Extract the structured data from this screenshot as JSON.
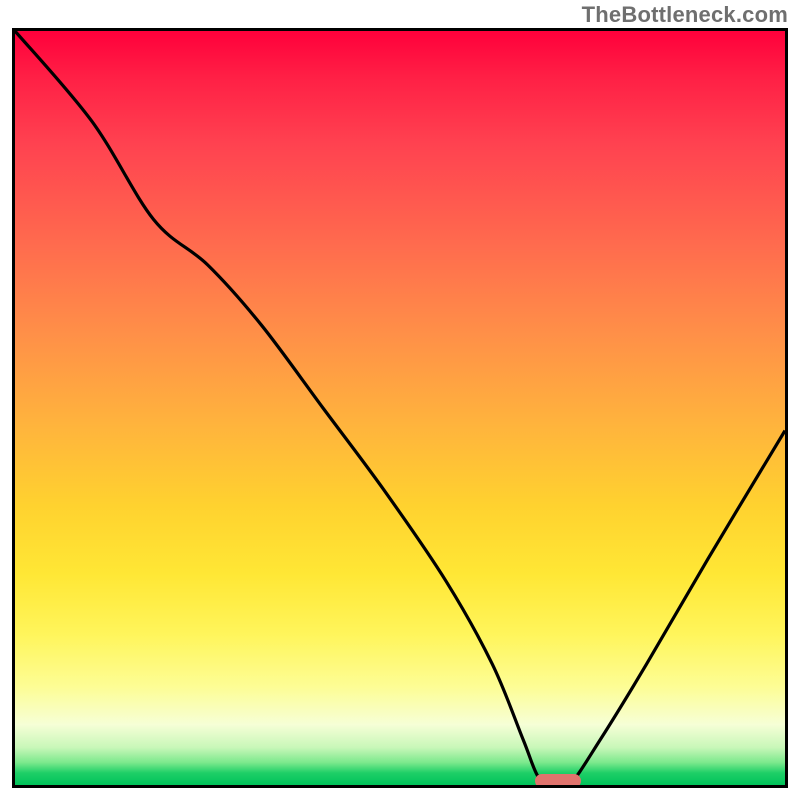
{
  "watermark": "TheBottleneck.com",
  "chart_data": {
    "type": "line",
    "title": "",
    "xlabel": "",
    "ylabel": "",
    "xlim": [
      0,
      100
    ],
    "ylim": [
      0,
      100
    ],
    "grid": false,
    "series": [
      {
        "name": "bottleneck-curve",
        "x": [
          0,
          10,
          18,
          25,
          32,
          40,
          48,
          56,
          62,
          66,
          68,
          70,
          72,
          76,
          82,
          90,
          100
        ],
        "y": [
          100,
          88,
          75,
          69,
          61,
          50,
          39,
          27,
          16,
          6,
          1,
          0,
          0,
          6,
          16,
          30,
          47
        ]
      }
    ],
    "annotations": [
      {
        "name": "optimal-marker",
        "x": 70.5,
        "y": 0.5,
        "color": "#e0736d"
      }
    ],
    "legend": false
  },
  "colors": {
    "frame": "#000000",
    "curve": "#000000",
    "marker": "#e0736d",
    "watermark": "#6f6f6f"
  }
}
